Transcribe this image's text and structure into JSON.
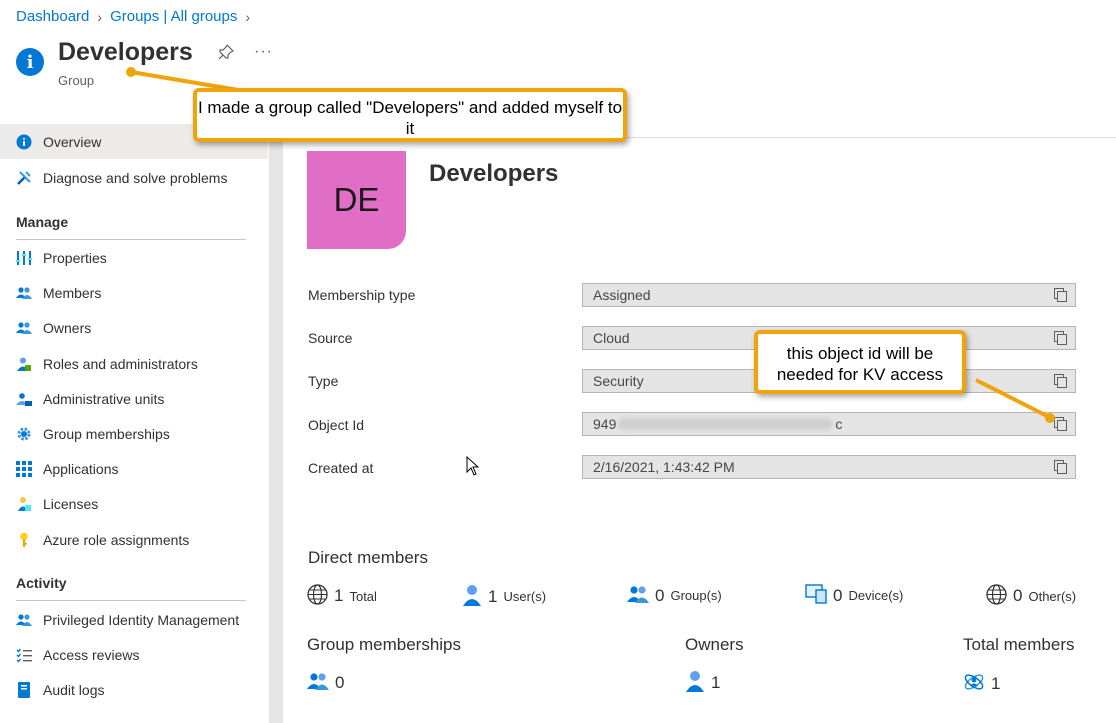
{
  "breadcrumb": [
    "Dashboard",
    "Groups | All groups"
  ],
  "header": {
    "title": "Developers",
    "subtitle": "Group"
  },
  "sidebar": {
    "items_top": [
      {
        "label": "Overview",
        "icon": "info-icon"
      },
      {
        "label": "Diagnose and solve problems",
        "icon": "wrench-icon"
      }
    ],
    "manage_heading": "Manage",
    "manage_items": [
      {
        "label": "Properties",
        "icon": "properties-icon"
      },
      {
        "label": "Members",
        "icon": "members-icon"
      },
      {
        "label": "Owners",
        "icon": "owners-icon"
      },
      {
        "label": "Roles and administrators",
        "icon": "roles-icon"
      },
      {
        "label": "Administrative units",
        "icon": "admin-units-icon"
      },
      {
        "label": "Group memberships",
        "icon": "gear-icon"
      },
      {
        "label": "Applications",
        "icon": "grid-icon"
      },
      {
        "label": "Licenses",
        "icon": "licenses-icon"
      },
      {
        "label": "Azure role assignments",
        "icon": "key-icon"
      }
    ],
    "activity_heading": "Activity",
    "activity_items": [
      {
        "label": "Privileged Identity Management",
        "icon": "pim-icon"
      },
      {
        "label": "Access reviews",
        "icon": "checklist-icon"
      },
      {
        "label": "Audit logs",
        "icon": "book-icon"
      }
    ]
  },
  "overview": {
    "avatar_initials": "DE",
    "avatar_color": "#e06ec6",
    "name": "Developers",
    "properties": [
      {
        "label": "Membership type",
        "value": "Assigned"
      },
      {
        "label": "Source",
        "value": "Cloud"
      },
      {
        "label": "Type",
        "value": "Security"
      },
      {
        "label": "Object Id",
        "value_prefix": "949",
        "value_suffix": "c"
      },
      {
        "label": "Created at",
        "value": "2/16/2021, 1:43:42 PM"
      }
    ],
    "direct_members_heading": "Direct members",
    "direct_members": [
      {
        "count": "1",
        "label": "Total",
        "icon": "globe-icon"
      },
      {
        "count": "1",
        "label": "User(s)",
        "icon": "user-icon"
      },
      {
        "count": "0",
        "label": "Group(s)",
        "icon": "group-icon"
      },
      {
        "count": "0",
        "label": "Device(s)",
        "icon": "device-icon"
      },
      {
        "count": "0",
        "label": "Other(s)",
        "icon": "globe-icon"
      }
    ],
    "summary": [
      {
        "heading": "Group memberships",
        "value": "0",
        "icon": "group-icon"
      },
      {
        "heading": "Owners",
        "value": "1",
        "icon": "user-icon"
      },
      {
        "heading": "Total members",
        "value": "1",
        "icon": "total-members-icon"
      }
    ]
  },
  "callouts": {
    "group_note": "I made a group called \"Developers\" and added myself to it",
    "object_id_note": "this object id will be needed for KV access"
  },
  "colors": {
    "accent": "#0078d4",
    "callout_border": "#f0a30a"
  }
}
